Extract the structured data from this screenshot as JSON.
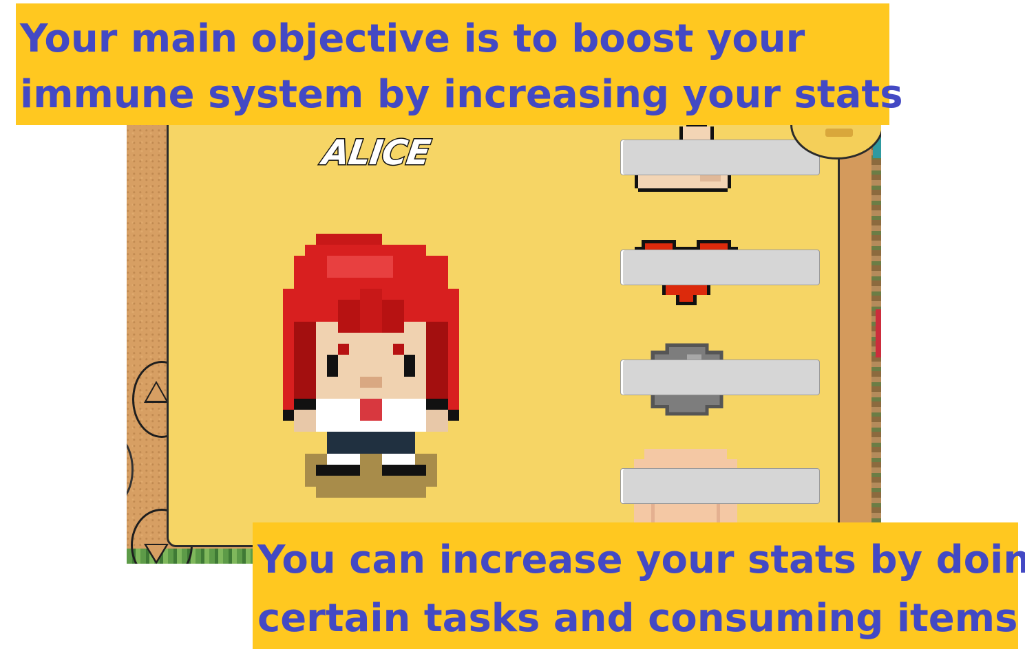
{
  "banners": {
    "top": {
      "line1": "Your main objective is to boost your",
      "line2": "immune system by increasing your stats"
    },
    "bottom": {
      "line1": "You can increase your stats by doing",
      "line2": "certain tasks and consuming items"
    }
  },
  "character": {
    "name": "ALICE"
  },
  "stats": [
    {
      "icon": "muscle-arm-icon",
      "level": 0
    },
    {
      "icon": "heart-icon",
      "level": 0
    },
    {
      "icon": "stone-icon",
      "level": 0
    },
    {
      "icon": "body-torso-icon",
      "level": 0
    }
  ],
  "colors": {
    "banner_bg": "#ffc820",
    "banner_text": "#4349c4",
    "panel_bg": "#f6d565",
    "bar_empty": "#d6d6d6",
    "hair": "#d81f1f"
  }
}
